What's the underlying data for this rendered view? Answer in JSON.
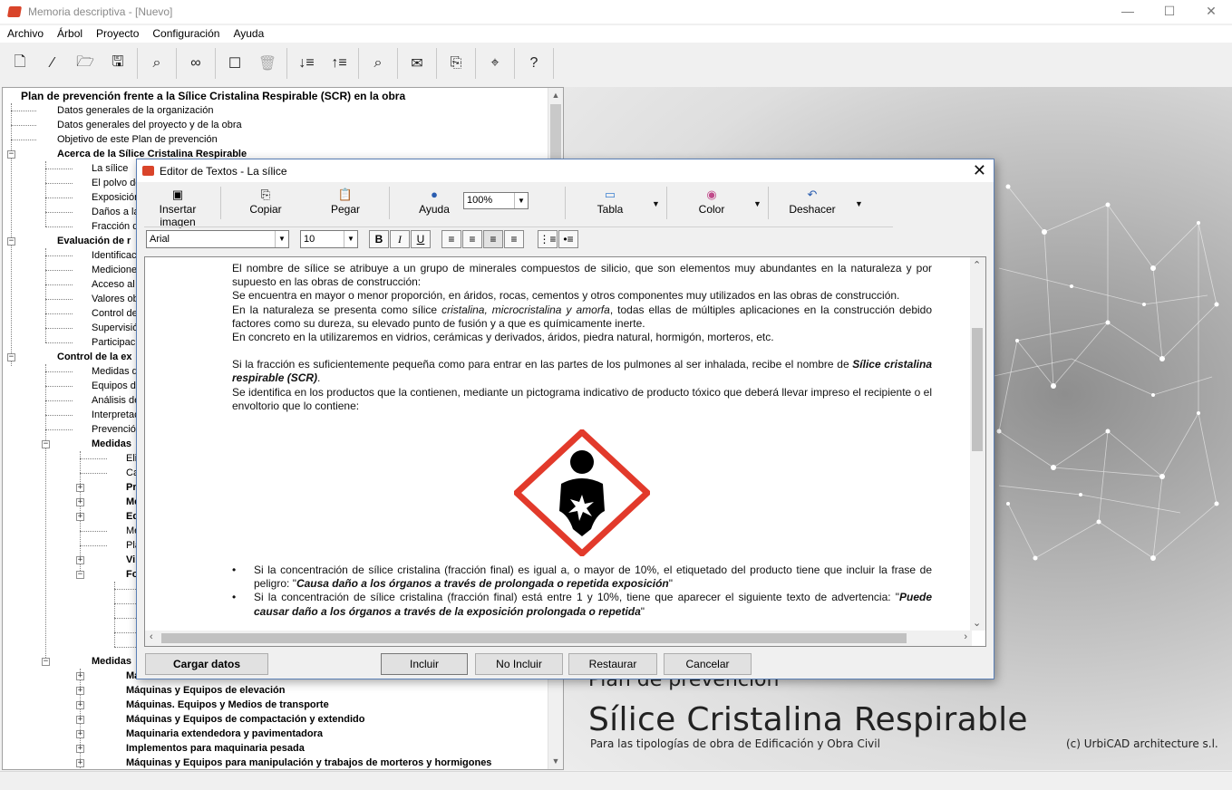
{
  "window": {
    "title": "Memoria descriptiva - [Nuevo]",
    "controls": [
      "—",
      "☐",
      "✕"
    ]
  },
  "menu": [
    "Archivo",
    "Árbol",
    "Proyecto",
    "Configuración",
    "Ayuda"
  ],
  "tree": {
    "root": "Plan de prevención frente a la Sílice Cristalina Respirable (SCR) en la obra",
    "items": [
      "Datos generales de la organización",
      "Datos generales del proyecto y de la obra",
      "Objetivo de este Plan de prevención",
      "Acerca de la Sílice Cristalina Respirable",
      "La sílice",
      "El polvo de",
      "Exposición",
      "Daños a la",
      "Fracción d",
      "Evaluación de r",
      "Identificac",
      "Mediciones",
      "Acceso al",
      "Valores ob",
      "Control de",
      "Supervisión",
      "Participació",
      "Control de la ex",
      "Medidas d",
      "Equipos de",
      "Análisis de",
      "Interpretac",
      "Prevención",
      "Medidas",
      "Eli",
      "Ca",
      "Pr",
      "Me",
      "Eq",
      "Me",
      "Pla",
      "Vi",
      "Fo",
      "Medidas",
      "Má",
      "Máquinas y Equipos de elevación",
      "Máquinas. Equipos y Medios de transporte",
      "Máquinas y Equipos de compactación y extendido",
      "Maquinaria extendedora y pavimentadora",
      "Implementos para maquinaria pesada",
      "Máquinas y Equipos para manipulación y trabajos de morteros y hormigones"
    ]
  },
  "splash": {
    "line1": "Plan de prevención",
    "line2": "Sílice Cristalina Respirable",
    "line3": "Para las tipologías de obra de Edificación y Obra Civil",
    "copyright": "(c)  UrbiCAD architecture s.l."
  },
  "dialog": {
    "title": "Editor de Textos - La sílice",
    "toolbar": {
      "insert_image": "Insertar imagen",
      "copy": "Copiar",
      "paste": "Pegar",
      "help": "Ayuda",
      "zoom": "100%",
      "table": "Tabla",
      "color": "Color",
      "undo": "Deshacer"
    },
    "format": {
      "font": "Arial",
      "size": "10",
      "bold": "B",
      "italic": "I",
      "underline": "U"
    },
    "content": {
      "p1": "El nombre de sílice se atribuye a un grupo de minerales compuestos de silicio, que son elementos muy abundantes en la naturaleza y por supuesto en las obras de construcción:",
      "p2": "Se encuentra en mayor o menor proporción, en áridos, rocas, cementos y otros componentes muy utilizados en las obras de construcción.",
      "p3a": "En la naturaleza se presenta como sílice ",
      "p3b": "cristalina, microcristalina y amorfa",
      "p3c": ", todas ellas de múltiples aplicaciones en la construcción debido  factores como su dureza, su elevado punto de fusión y a que es químicamente inerte.",
      "p4": "En concreto en la utilizaremos en vidrios, cerámicas y derivados, áridos, piedra natural, hormigón, morteros, etc.",
      "p5a": "Si la fracción es suficientemente pequeña como para entrar en las partes de los pulmones al ser inhalada, recibe el nombre de ",
      "p5b": "Sílice cristalina respirable (SCR)",
      "p5c": ".",
      "p6": "Se identifica en los productos que la contienen, mediante un pictograma indicativo de producto tóxico que deberá llevar impreso el recipiente o el envoltorio que lo contiene:",
      "b1a": "Si la concentración de sílice cristalina (fracción final) es igual a, o mayor de 10%, el etiquetado del producto tiene que incluir la frase de peligro: \"",
      "b1b": "Causa daño a los órganos a través de prolongada o repetida exposición",
      "b1c": "\"",
      "b2a": "Si la concentración de sílice cristalina (fracción final) está entre 1 y 10%, tiene que aparecer el siguiente texto de advertencia: \"",
      "b2b": "Puede causar daño a los órganos a través de la exposición prolongada o repetida",
      "b2c": "\""
    },
    "buttons": {
      "load": "Cargar datos",
      "include": "Incluir",
      "exclude": "No Incluir",
      "restore": "Restaurar",
      "cancel": "Cancelar"
    }
  }
}
